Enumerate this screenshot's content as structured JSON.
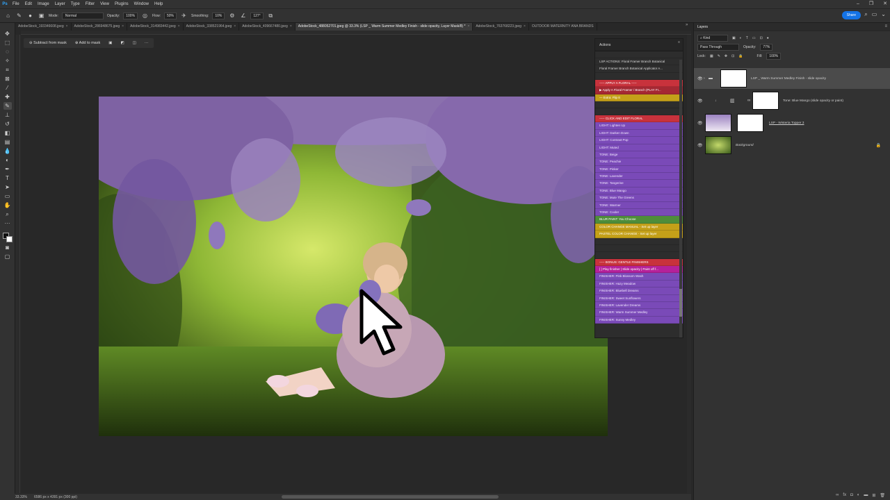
{
  "menubar": {
    "logo": "Ps",
    "items": [
      "File",
      "Edit",
      "Image",
      "Layer",
      "Type",
      "Filter",
      "View",
      "Plugins",
      "Window",
      "Help"
    ],
    "window_controls": [
      "–",
      "❐",
      "✕"
    ]
  },
  "options": {
    "mode_label": "Mode:",
    "mode_value": "Normal",
    "opacity_label": "Opacity:",
    "opacity_value": "100%",
    "flow_label": "Flow:",
    "flow_value": "50%",
    "smoothing_label": "Smoothing:",
    "smoothing_value": "10%",
    "angle_value": "127°",
    "share_label": "Share"
  },
  "tabs": [
    {
      "label": "AdobeStock_193346608.jpeg",
      "active": false
    },
    {
      "label": "AdobeStock_286948675.jpeg",
      "active": false
    },
    {
      "label": "AdobeStock_314983442.jpeg",
      "active": false
    },
    {
      "label": "AdobeStock_338521964.jpeg",
      "active": false
    },
    {
      "label": "AdobeStock_409667480.jpeg",
      "active": false
    },
    {
      "label": "AdobeStock_488052701.jpeg @ 33.3% (LSP _ Warm Summer Medley Finish - slide opacity, Layer Mask/8) *",
      "active": true
    },
    {
      "label": "AdobeStock_763768223.jpeg",
      "active": false
    },
    {
      "label": "OUTDOOR MATERNITY ANA BRANDS",
      "active": false
    }
  ],
  "tabs_more": "»",
  "context": {
    "subtract": "Subtract from mask",
    "add": "Add to mask",
    "more": "···"
  },
  "status": {
    "zoom": "33.33%",
    "doc": "6586 px x 4391 px (300 ppi)"
  },
  "actions": {
    "title": "Actions",
    "rows": [
      {
        "t": "",
        "c": "sep"
      },
      {
        "t": "LSP ACTIONS: Floral Framer Branch Botanical",
        "c": "plain"
      },
      {
        "t": "Floral Framer Branch Botanical Applicator A...",
        "c": "plain"
      },
      {
        "t": "",
        "c": "sep"
      },
      {
        "t": "----- APPLY A FLORAL -----",
        "c": "red"
      },
      {
        "t": "▶ Apply A Floral Framer / Branch (PLAY FI...",
        "c": "darkred"
      },
      {
        "t": "— Extra: Flip It",
        "c": "gold"
      },
      {
        "t": "",
        "c": "sep"
      },
      {
        "t": "",
        "c": "sep"
      },
      {
        "t": "----- CLICK AND EDIT FLORAL",
        "c": "red"
      },
      {
        "t": "LIGHT: Lighten Up",
        "c": "purple"
      },
      {
        "t": "LIGHT: Darken Down",
        "c": "purple"
      },
      {
        "t": "LIGHT: Contrast Pop",
        "c": "purple"
      },
      {
        "t": "LIGHT: Muted",
        "c": "purple"
      },
      {
        "t": "TONE: Beige",
        "c": "purple"
      },
      {
        "t": "TONE: Peachie",
        "c": "purple"
      },
      {
        "t": "TONE: Pinker",
        "c": "purple"
      },
      {
        "t": "TONE: Lavender",
        "c": "purple"
      },
      {
        "t": "TONE: Tangerine",
        "c": "purple"
      },
      {
        "t": "TONE: Blue Mango",
        "c": "purple"
      },
      {
        "t": "TONE: Mute The Greens",
        "c": "purple"
      },
      {
        "t": "TONE: Warmer",
        "c": "purple"
      },
      {
        "t": "TONE: Cooler",
        "c": "purple"
      },
      {
        "t": "BLUR PAINT: You Choose",
        "c": "green"
      },
      {
        "t": "COLOR CHANGE MANUAL - Set up layer",
        "c": "gold"
      },
      {
        "t": "PASTEL COLOR CHANGE - Set up layer",
        "c": "gold"
      },
      {
        "t": "",
        "c": "sep"
      },
      {
        "t": "",
        "c": "sep"
      },
      {
        "t": "",
        "c": "sep"
      },
      {
        "t": "----- BONUS: GENTLE FINISHERS",
        "c": "red"
      },
      {
        "t": "[ ] Play finisher | Slide opacity | Paint off f...",
        "c": "magenta"
      },
      {
        "t": "FINISHER: Pink Blossom Wash",
        "c": "purple"
      },
      {
        "t": "FINISHER: Hazy Meadow",
        "c": "purple"
      },
      {
        "t": "FINISHER: Bluebell Dreams",
        "c": "purple"
      },
      {
        "t": "FINISHER: Sweet Sunflowers",
        "c": "purple"
      },
      {
        "t": "FINISHER: Lavender Dreams",
        "c": "purple"
      },
      {
        "t": "FINISHER: Warm Summer Medley",
        "c": "purple"
      },
      {
        "t": "FINISHER: Sunny Medley",
        "c": "purple"
      }
    ]
  },
  "layers": {
    "title": "Layers",
    "kind": "Kind",
    "blend": "Pass Through",
    "opacity_label": "Opacity:",
    "opacity_value": "77%",
    "lock_label": "Lock:",
    "fill_label": "Fill:",
    "fill_value": "100%",
    "items": [
      {
        "name": "LSP _ Warm Summer Medley Finish - slide opacity",
        "selected": true
      },
      {
        "name": "Tone: Blue Mango (slide opacity or paint)",
        "selected": false
      },
      {
        "name": "LSP - Wisteria Topper 3",
        "selected": false
      },
      {
        "name": "Background",
        "selected": false
      }
    ]
  },
  "icons": {
    "eye": "eye-icon",
    "lock": "lock-icon",
    "home": "home-icon",
    "brush": "brush-icon",
    "search": "search-icon"
  }
}
